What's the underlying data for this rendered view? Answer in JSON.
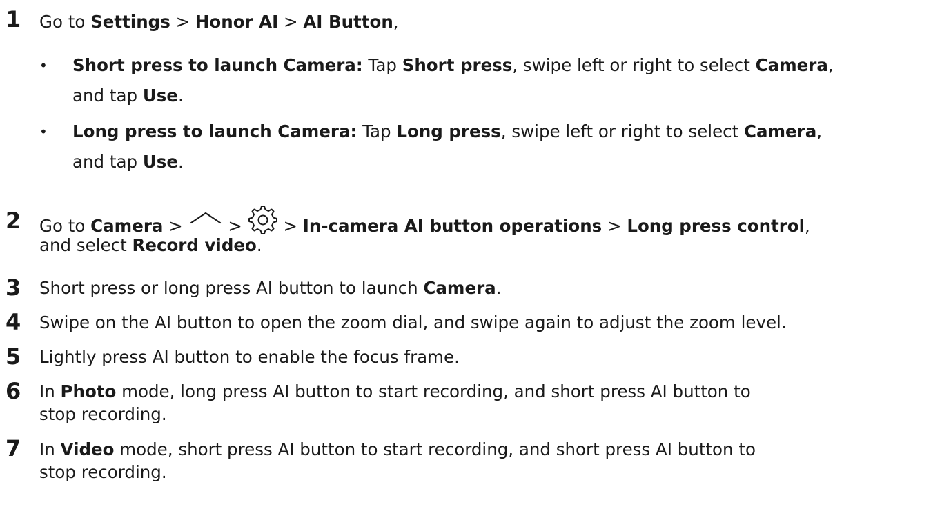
{
  "steps": [
    {
      "number": "1",
      "parts": [
        "Go to ",
        "Settings",
        " > ",
        "Honor AI",
        " > ",
        "AI Button",
        ","
      ],
      "bullets": [
        {
          "line1": [
            "Short press to launch Camera:",
            " Tap ",
            "Short press",
            ", swipe left or right to select ",
            "Camera",
            ","
          ],
          "line2": [
            "and tap ",
            "Use",
            "."
          ]
        },
        {
          "line1": [
            "Long press to launch Camera:",
            " Tap ",
            "Long press",
            ", swipe left or right to select ",
            "Camera",
            ","
          ],
          "line2": [
            "and tap ",
            "Use",
            "."
          ]
        }
      ]
    },
    {
      "number": "2",
      "line1": [
        "Go to ",
        "Camera",
        " > ",
        " > ",
        " > ",
        "In-camera AI button operations",
        " > ",
        "Long press control",
        ","
      ],
      "line2": [
        "and select ",
        "Record video",
        "."
      ],
      "icons": [
        "chevron-up-icon",
        "gear-icon"
      ]
    },
    {
      "number": "3",
      "parts": [
        "Short press or long press AI button to launch ",
        "Camera",
        "."
      ]
    },
    {
      "number": "4",
      "parts": [
        "Swipe on the AI button to open the zoom dial, and swipe again to adjust the zoom level."
      ]
    },
    {
      "number": "5",
      "parts": [
        "Lightly press AI button to enable the focus frame."
      ]
    },
    {
      "number": "6",
      "line1": [
        "In ",
        "Photo",
        " mode, long press AI button to start recording, and short press AI button to"
      ],
      "line2": [
        "stop recording."
      ]
    },
    {
      "number": "7",
      "line1": [
        "In ",
        "Video",
        " mode, short press AI button to start recording, and short press AI button to"
      ],
      "line2": [
        "stop recording."
      ]
    }
  ]
}
